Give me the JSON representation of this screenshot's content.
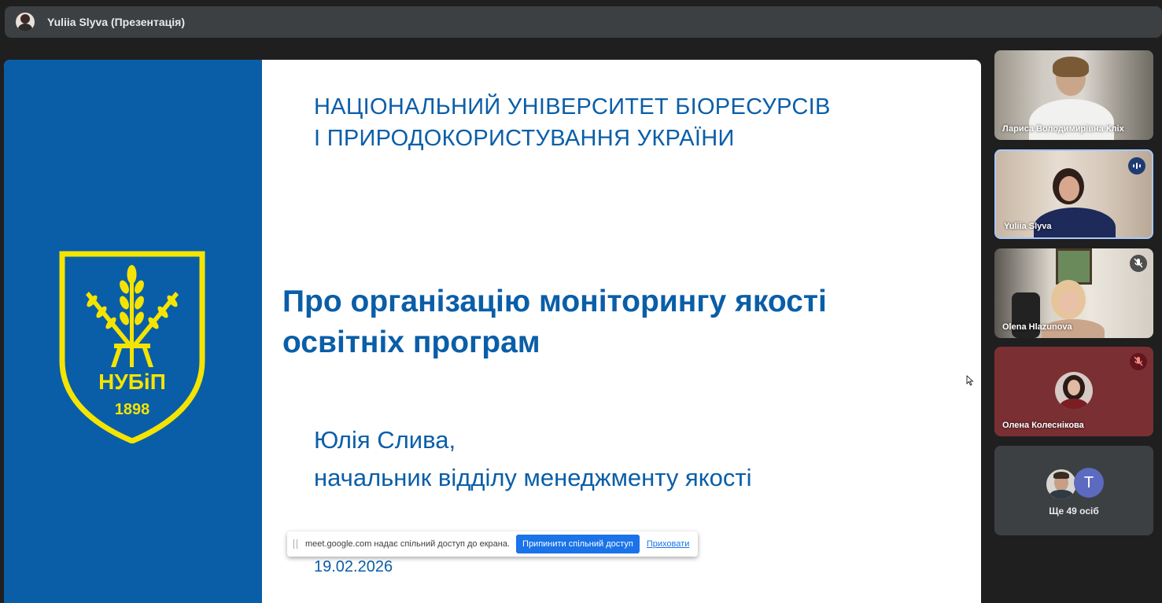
{
  "presenter_bar": {
    "title": "Yuliia Slyva (Презентація)"
  },
  "slide": {
    "university": [
      "НАЦІОНАЛЬНИЙ УНІВЕРСИТЕТ БІОРЕСУРСІВ",
      "І ПРИРОДОКОРИСТУВАННЯ УКРАЇНИ"
    ],
    "title": [
      "Про організацію моніторингу якості",
      "освітніх програм"
    ],
    "author": [
      "Юлія Слива,",
      "начальник відділу менеджменту якості"
    ],
    "date": "19.02.2026",
    "logo_text": "НУБіП",
    "logo_year": "1898",
    "colors": {
      "blue": "#0a5ea8",
      "yellow": "#f5e400"
    }
  },
  "share_banner": {
    "message": "meet.google.com надає спільний доступ до екрана.",
    "stop_label": "Припинити спільний доступ",
    "hide_label": "Приховати"
  },
  "participants": [
    {
      "name": "Лариса Володимирівна Кліх"
    },
    {
      "name": "Yuliia Slyva",
      "status": "speaking"
    },
    {
      "name": "Olena Hlazunova",
      "status": "muted"
    },
    {
      "name": "Олена Колеснікова",
      "status": "muted"
    }
  ],
  "others": {
    "avatar_letter": "T",
    "label": "Ще 49 осіб"
  }
}
